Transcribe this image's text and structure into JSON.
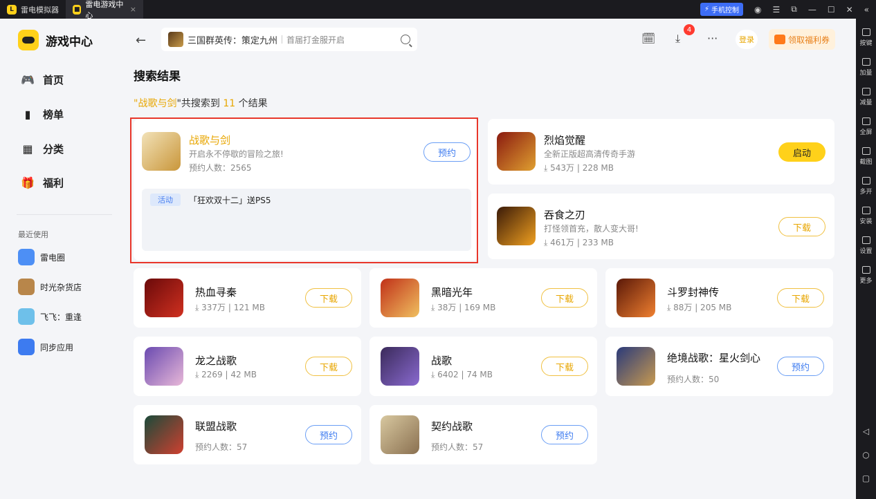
{
  "window": {
    "tab1": "雷电模拟器",
    "tab2": "雷电游戏中心",
    "tab_close": "×",
    "phone_control": "手机控制",
    "controls": [
      "☰",
      "⧉",
      "—",
      "☐",
      "✕",
      "«"
    ]
  },
  "right_toolbar": [
    {
      "label": "按键",
      "icon": "keyboard-icon"
    },
    {
      "label": "加量",
      "icon": "volume-up-icon"
    },
    {
      "label": "减量",
      "icon": "volume-down-icon"
    },
    {
      "label": "全屏",
      "icon": "fullscreen-icon"
    },
    {
      "label": "截图",
      "icon": "scissors-icon"
    },
    {
      "label": "多开",
      "icon": "multi-instance-icon"
    },
    {
      "label": "安装",
      "icon": "install-icon"
    },
    {
      "label": "设置",
      "icon": "settings-icon"
    },
    {
      "label": "更多",
      "icon": "more-icon"
    }
  ],
  "android_nav": [
    "◁",
    "○",
    "▢"
  ],
  "sidebar": {
    "title": "游戏中心",
    "nav": [
      {
        "label": "首页",
        "icon": "gamepad-icon"
      },
      {
        "label": "榜单",
        "icon": "ranking-icon"
      },
      {
        "label": "分类",
        "icon": "category-icon"
      },
      {
        "label": "福利",
        "icon": "gift-icon"
      }
    ],
    "recent_title": "最近使用",
    "recent": [
      {
        "label": "雷电圈",
        "color": "#4d8ff5"
      },
      {
        "label": "时光杂货店",
        "color": "#b8864a"
      },
      {
        "label": "飞飞：重逢",
        "color": "#6ec0ea"
      },
      {
        "label": "同步应用",
        "color": "#3d7bf0"
      }
    ]
  },
  "header": {
    "search_text": "三国群英传：策定九州",
    "search_sub": "首届打金服开启",
    "download_badge": "4",
    "login": "登录",
    "coupon": "领取福利券"
  },
  "content": {
    "page_title": "搜索结果",
    "result_prefix": "\"",
    "keyword": "战歌与剑",
    "result_mid": "\"共搜索到 ",
    "count": "11",
    "result_suffix": " 个结果"
  },
  "featured": {
    "name": "战歌与剑",
    "desc": "开启永不停歇的冒险之旅!",
    "meta": "预约人数：2565",
    "button": "预约",
    "activity_tag": "活动",
    "activity_text": "「狂欢双十二」送PS5"
  },
  "games": [
    {
      "name": "烈焰觉醒",
      "desc": "全新正版超高清传奇手游",
      "meta": "⤓ 543万 | 228 MB",
      "button": "启动"
    },
    {
      "name": "吞食之刃",
      "desc": "打怪领首充，散人变大哥!",
      "meta": "⤓ 461万 | 233 MB",
      "button": "下载"
    },
    {
      "name": "热血寻秦",
      "meta": "⤓ 337万 | 121 MB",
      "button": "下载"
    },
    {
      "name": "黑暗光年",
      "meta": "⤓ 38万 | 169 MB",
      "button": "下载"
    },
    {
      "name": "斗罗封神传",
      "meta": "⤓ 88万 | 205 MB",
      "button": "下载"
    },
    {
      "name": "龙之战歌",
      "meta": "⤓ 2269 | 42 MB",
      "button": "下载"
    },
    {
      "name": "战歌",
      "meta": "⤓ 6402 | 74 MB",
      "button": "下载"
    },
    {
      "name": "绝境战歌：星火剑心",
      "meta": "预约人数：50",
      "button": "预约"
    },
    {
      "name": "联盟战歌",
      "meta": "预约人数：57",
      "button": "预约"
    },
    {
      "name": "契约战歌",
      "meta": "预约人数：57",
      "button": "预约"
    }
  ]
}
